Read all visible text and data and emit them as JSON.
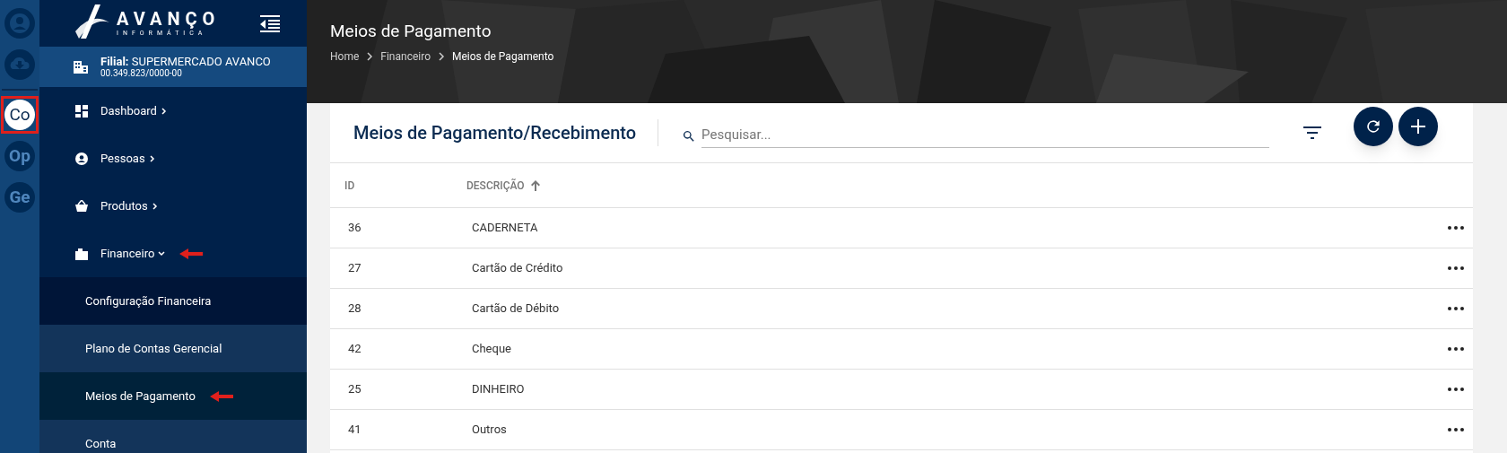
{
  "rail": [
    {
      "kind": "icon",
      "selected": false
    },
    {
      "kind": "icon",
      "selected": false
    },
    {
      "kind": "text",
      "label": "Co",
      "selected": true
    },
    {
      "kind": "text",
      "label": "Op",
      "selected": false
    },
    {
      "kind": "text",
      "label": "Ge",
      "selected": false
    }
  ],
  "logo": {
    "title": "AVANÇO",
    "subtitle": "INFORMÁTICA"
  },
  "branch": {
    "label": "Filial:",
    "name": "SUPERMERCADO AVANCO",
    "id": "00.349.823/0000-00"
  },
  "menu": [
    {
      "label": "Dashboard",
      "expanded": false,
      "annotated": false
    },
    {
      "label": "Pessoas",
      "expanded": false,
      "annotated": false
    },
    {
      "label": "Produtos",
      "expanded": false,
      "annotated": false
    },
    {
      "label": "Financeiro",
      "expanded": true,
      "annotated": true,
      "children": [
        {
          "label": "Configuração Financeira",
          "selected": false,
          "annotated": false
        },
        {
          "label": "Plano de Contas Gerencial",
          "selected": false,
          "annotated": false
        },
        {
          "label": "Meios de Pagamento",
          "selected": true,
          "annotated": true
        },
        {
          "label": "Conta",
          "selected": false,
          "annotated": false
        }
      ]
    }
  ],
  "page_title": "Meios de Pagamento",
  "breadcrumb": [
    "Home",
    "Financeiro",
    "Meios de Pagamento"
  ],
  "card": {
    "title": "Meios de Pagamento/Recebimento",
    "search": {
      "placeholder": "Pesquisar..."
    }
  },
  "table": {
    "columns": [
      {
        "label": "ID",
        "sorted": false
      },
      {
        "label": "DESCRIÇÃO",
        "sorted": true
      }
    ],
    "rows": [
      {
        "id": "36",
        "description": "CADERNETA"
      },
      {
        "id": "27",
        "description": "Cartão de Crédito"
      },
      {
        "id": "28",
        "description": "Cartão de Débito"
      },
      {
        "id": "42",
        "description": "Cheque"
      },
      {
        "id": "25",
        "description": "DINHEIRO"
      },
      {
        "id": "41",
        "description": "Outros"
      }
    ]
  }
}
